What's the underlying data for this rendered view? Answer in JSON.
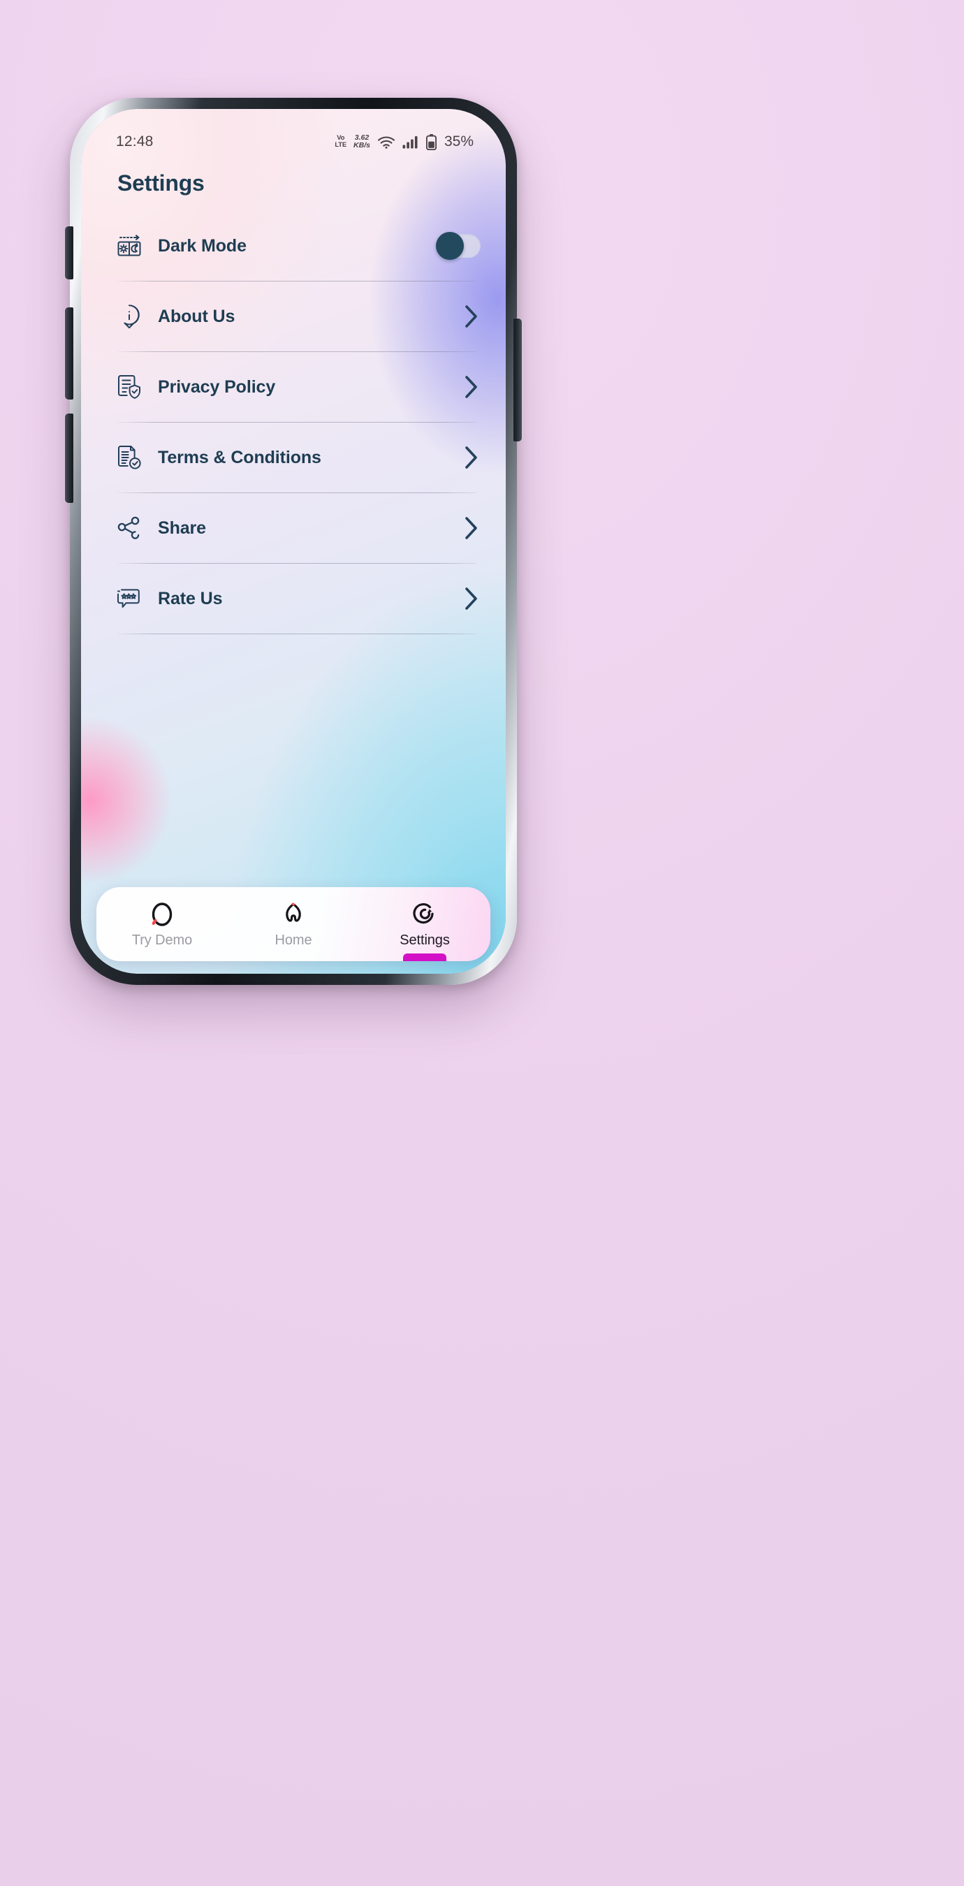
{
  "status_bar": {
    "clock": "12:48",
    "volte_top": "Vo",
    "volte_bottom": "LTE",
    "net_speed_value": "3.62",
    "net_speed_unit": "KB/s",
    "wifi_icon": "wifi-icon",
    "signal_icon": "cellular-signal-icon",
    "battery_icon": "battery-icon",
    "battery_percent": "35%"
  },
  "header": {
    "title": "Settings"
  },
  "settings": {
    "items": [
      {
        "label": "Dark Mode",
        "icon": "dark-mode-icon",
        "control": "toggle",
        "toggle_on": false
      },
      {
        "label": "About Us",
        "icon": "info-bubble-icon",
        "control": "chevron"
      },
      {
        "label": "Privacy Policy",
        "icon": "document-shield-icon",
        "control": "chevron"
      },
      {
        "label": "Terms & Conditions",
        "icon": "document-check-icon",
        "control": "chevron"
      },
      {
        "label": "Share",
        "icon": "share-nodes-icon",
        "control": "chevron"
      },
      {
        "label": "Rate Us",
        "icon": "rate-stars-icon",
        "control": "chevron"
      }
    ]
  },
  "bottom_nav": {
    "tabs": [
      {
        "label": "Try Demo",
        "icon": "demo-ring-icon",
        "active": false
      },
      {
        "label": "Home",
        "icon": "home-icon",
        "active": false
      },
      {
        "label": "Settings",
        "icon": "settings-spiral-icon",
        "active": true
      }
    ]
  },
  "colors": {
    "accent_navy": "#1e3d52",
    "active_indicator": "#d410c6",
    "toggle_knob": "#23495e",
    "inactive_label": "#9b9ba1"
  }
}
